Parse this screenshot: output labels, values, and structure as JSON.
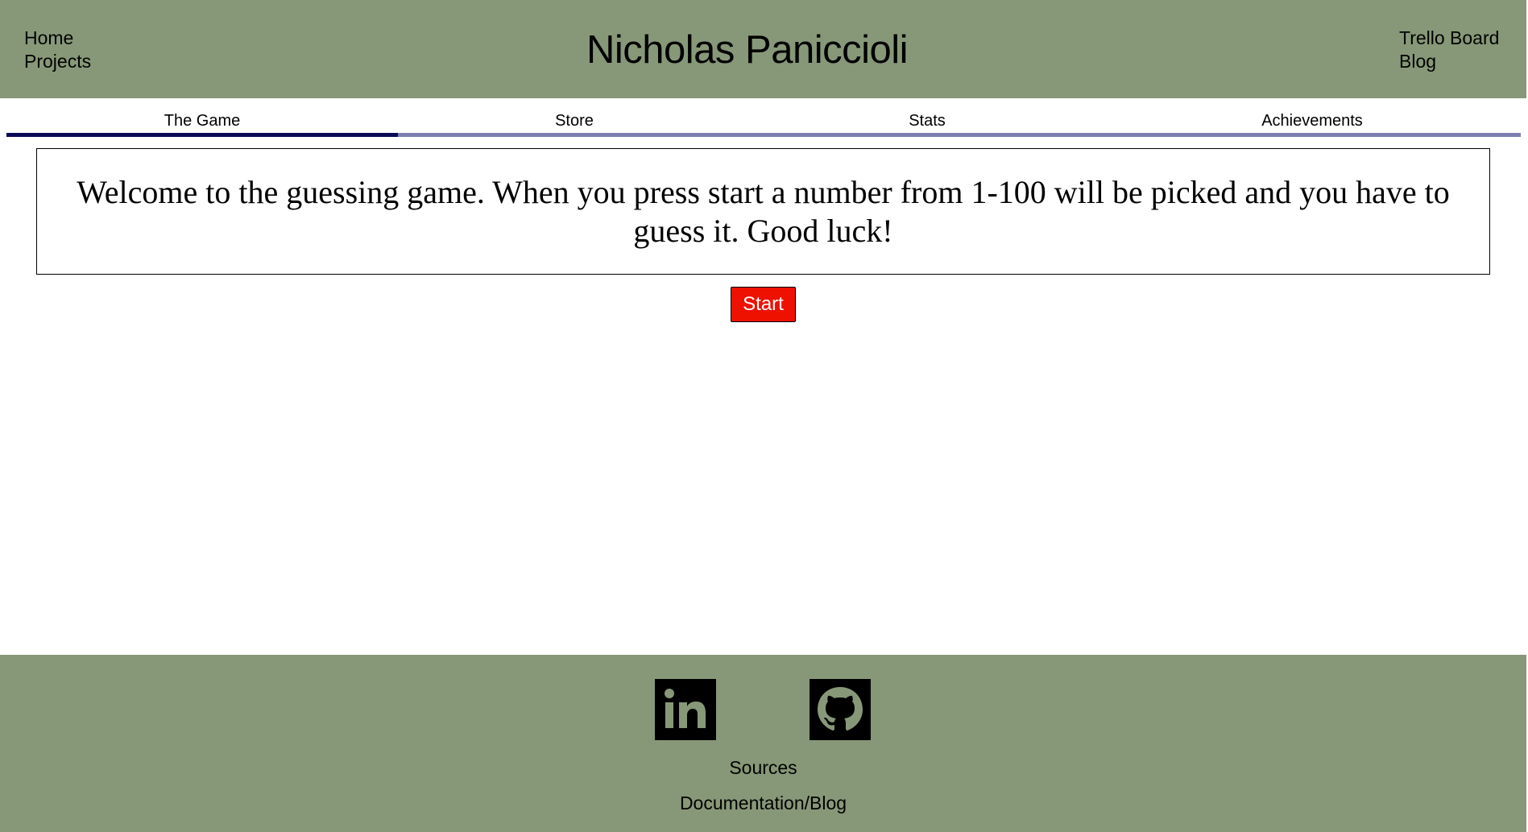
{
  "header": {
    "title": "Nicholas Paniccioli",
    "nav_left": [
      "Home",
      "Projects"
    ],
    "nav_right": [
      "Trello Board",
      "Blog"
    ],
    "background_color": "#879878"
  },
  "tabs": [
    {
      "label": "The Game",
      "active": true
    },
    {
      "label": "Store",
      "active": false
    },
    {
      "label": "Stats",
      "active": false
    },
    {
      "label": "Achievements",
      "active": false
    }
  ],
  "tab_colors": {
    "active": "#0a0a55",
    "inactive": "#7c7fae"
  },
  "game": {
    "welcome_text": "Welcome to the guessing game. When you press start a number from 1-100 will be picked and you have to guess it. Good luck!",
    "start_label": "Start",
    "start_color": "#ee1100"
  },
  "footer": {
    "icons": [
      "linkedin-icon",
      "github-icon"
    ],
    "links": [
      "Sources",
      "Documentation/Blog"
    ]
  }
}
